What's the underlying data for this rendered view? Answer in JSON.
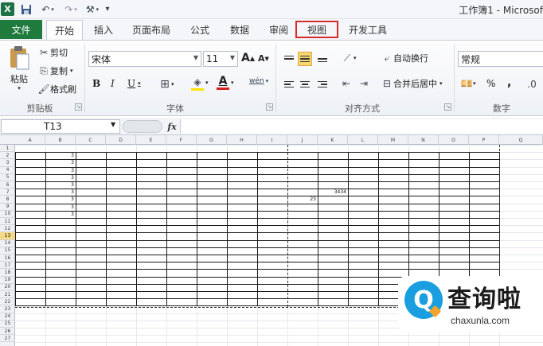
{
  "window": {
    "title": "工作簿1 - Microsof",
    "app_icon": "X"
  },
  "qat": {
    "icons": [
      "excel-app-icon",
      "save-icon",
      "undo-icon",
      "redo-icon",
      "customize-icon"
    ]
  },
  "tabs": {
    "file": "文件",
    "items": [
      "开始",
      "插入",
      "页面布局",
      "公式",
      "数据",
      "审阅",
      "视图",
      "开发工具"
    ],
    "active": "开始",
    "highlighted": "视图"
  },
  "ribbon": {
    "clipboard": {
      "label": "剪贴板",
      "paste": "粘贴",
      "cut": "剪切",
      "copy": "复制",
      "format_painter": "格式刷"
    },
    "font": {
      "label": "字体",
      "font_name": "宋体",
      "font_size": "11",
      "grow": "A",
      "shrink": "A",
      "bold": "B",
      "italic": "I",
      "underline": "U",
      "font_color_letter": "A",
      "phonetic": "wén"
    },
    "alignment": {
      "label": "对齐方式",
      "wrap_text": "自动换行",
      "merge_center": "合并后居中"
    },
    "number": {
      "label": "数字",
      "format": "常规",
      "percent": "%",
      "comma": ","
    },
    "colors": {
      "highlight_fill": "#f9d773",
      "font_red": "#d61f1f",
      "fill_yellow": "#ffe100",
      "file_tab": "#1f7a3d",
      "tab_highlight": "#d62b2b"
    }
  },
  "formula_bar": {
    "name_box": "T13",
    "fx": "fx",
    "formula": ""
  },
  "sheet": {
    "columns": [
      "A",
      "B",
      "C",
      "D",
      "E",
      "F",
      "G",
      "H",
      "I",
      "J",
      "K",
      "L",
      "M",
      "N",
      "O",
      "P",
      "Q"
    ],
    "rows": [
      "1",
      "2",
      "3",
      "4",
      "5",
      "6",
      "7",
      "8",
      "9",
      "10",
      "11",
      "12",
      "13",
      "14",
      "15",
      "16",
      "17",
      "18",
      "19",
      "20",
      "21",
      "22",
      "23",
      "24",
      "25",
      "26",
      "27"
    ],
    "active_row": "13",
    "values": {
      "b2": "3",
      "b3": "3",
      "b4": "3",
      "b5": "3",
      "b6": "3",
      "b7": "3",
      "b8": "3",
      "b9": "3",
      "b10": "3",
      "k7": "3434",
      "j8": "23"
    }
  },
  "watermark": {
    "cn": "查询啦",
    "en": "chaxunla.com",
    "logo": "Q"
  }
}
